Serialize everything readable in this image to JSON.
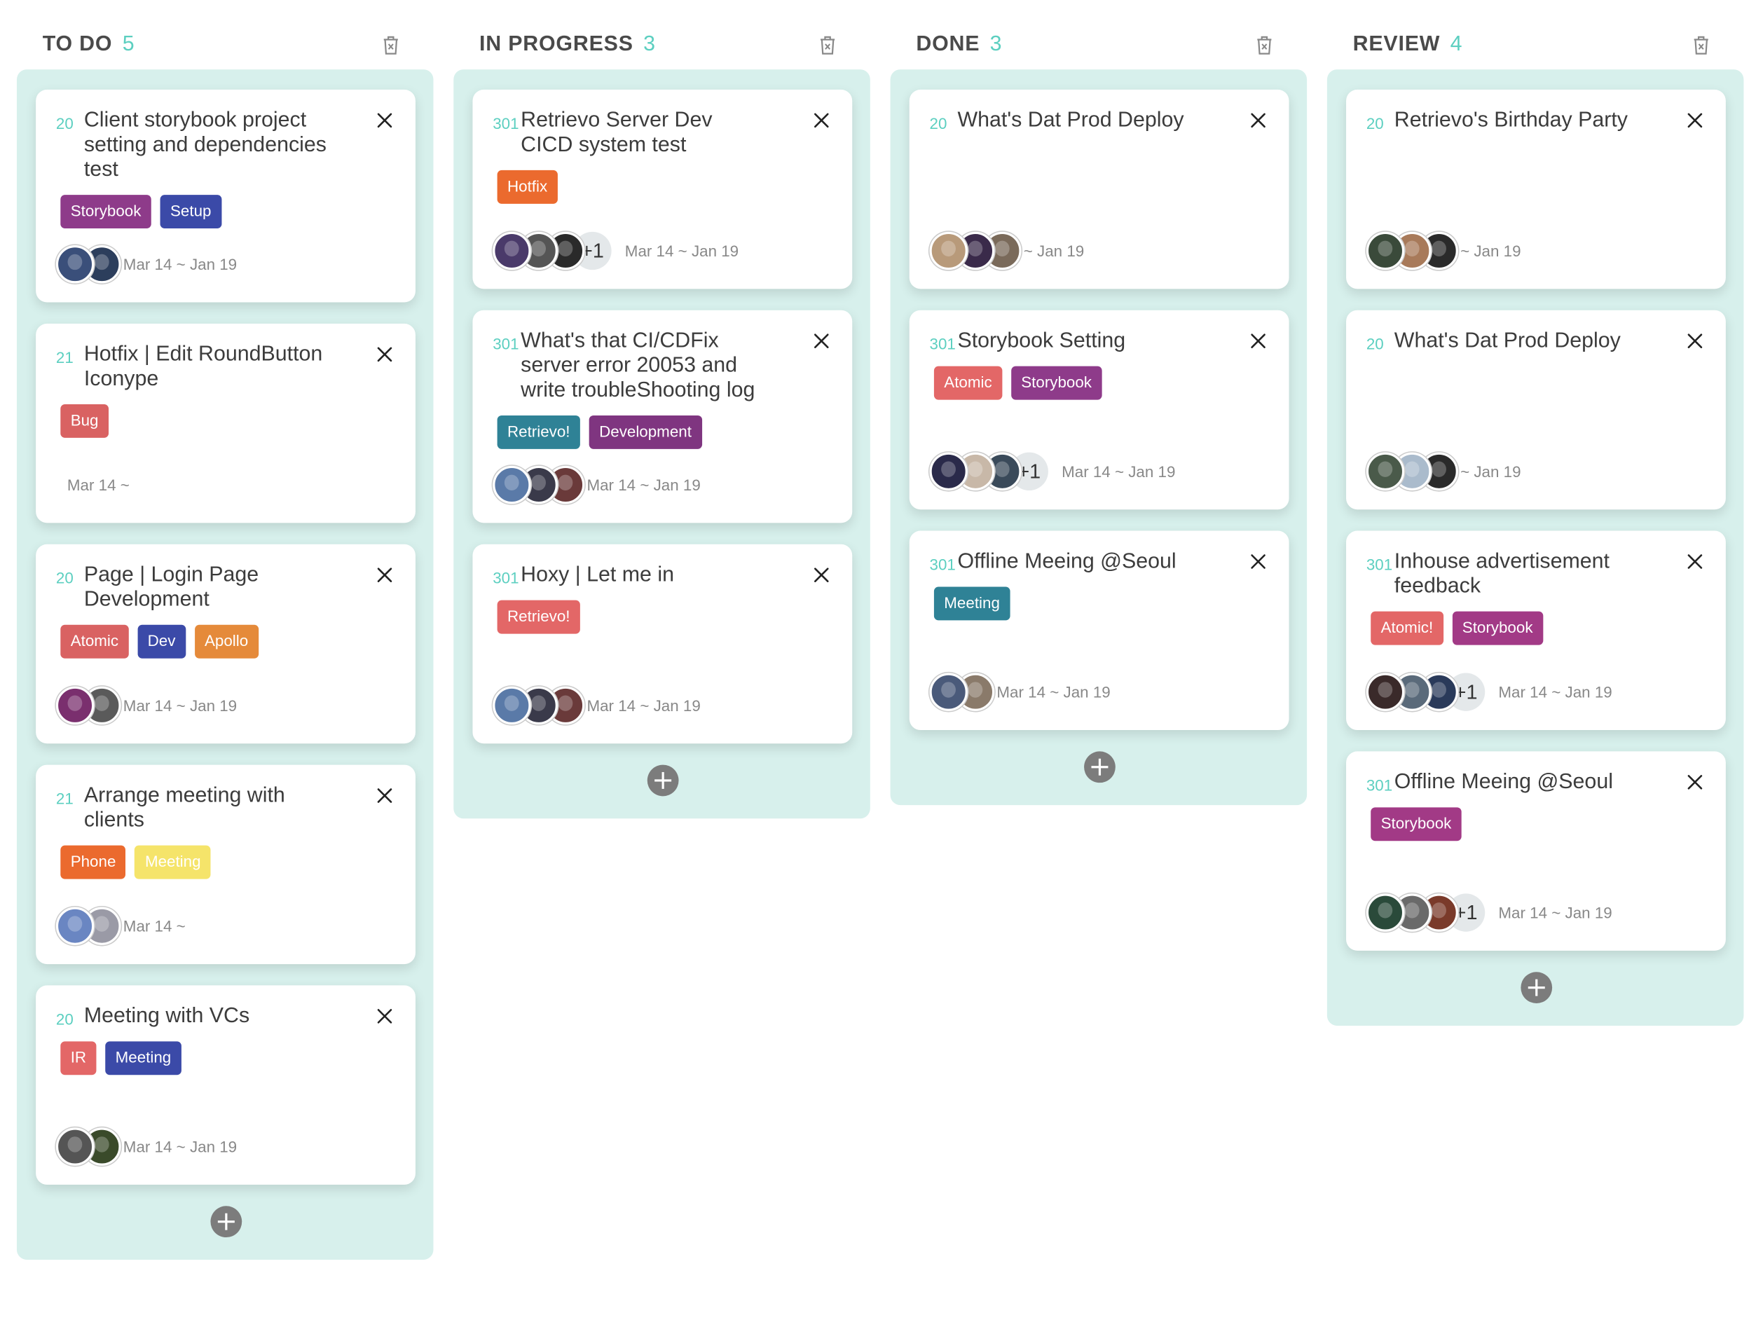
{
  "columns": [
    {
      "title": "TO DO",
      "count": "5",
      "cards": [
        {
          "num": "20",
          "title": "Client storybook project setting and dependencies test",
          "tags": [
            {
              "label": "Storybook",
              "color": "#8e3b8a"
            },
            {
              "label": "Setup",
              "color": "#3b4aa8"
            }
          ],
          "avatars": [
            "#3a4f7a",
            "#2c3e5c"
          ],
          "more": "",
          "dates": "Mar 14 ~ Jan 19"
        },
        {
          "num": "21",
          "title": "Hotfix | Edit RoundButton Iconype",
          "tags": [
            {
              "label": "Bug",
              "color": "#d96262"
            }
          ],
          "avatars": [],
          "more": "",
          "dates": "Mar 14 ~"
        },
        {
          "num": "20",
          "title": "Page | Login Page Development",
          "tags": [
            {
              "label": "Atomic",
              "color": "#d96262"
            },
            {
              "label": "Dev",
              "color": "#3b4aa8"
            },
            {
              "label": "Apollo",
              "color": "#e58a3a"
            }
          ],
          "avatars": [
            "#7a2f6e",
            "#5a5a5a"
          ],
          "more": "",
          "dates": "Mar 14 ~ Jan 19"
        },
        {
          "num": "21",
          "title": "Arrange meeting with clients",
          "tags": [
            {
              "label": "Phone",
              "color": "#eb6a2e"
            },
            {
              "label": "Meeting",
              "color": "#f5e46a"
            }
          ],
          "avatars": [
            "#6a86c2",
            "#9a9aa6"
          ],
          "more": "",
          "dates": "Mar 14 ~"
        },
        {
          "num": "20",
          "title": "Meeting with VCs",
          "tags": [
            {
              "label": "IR",
              "color": "#e36767"
            },
            {
              "label": "Meeting",
              "color": "#3b4aa8"
            }
          ],
          "avatars": [
            "#555555",
            "#3a4a2a"
          ],
          "more": "",
          "dates": "Mar 14 ~ Jan 19"
        }
      ]
    },
    {
      "title": "IN PROGRESS",
      "count": "3",
      "cards": [
        {
          "num": "301",
          "title": "Retrievo Server Dev CICD system test",
          "tags": [
            {
              "label": "Hotfix",
              "color": "#eb6a2e"
            }
          ],
          "avatars": [
            "#4a3a6a",
            "#555555",
            "#2a2a2a"
          ],
          "more": "+1",
          "dates": "Mar 14 ~ Jan 19"
        },
        {
          "num": "301",
          "title": "What's that CI/CDFix server error 20053 and write troubleShooting log",
          "tags": [
            {
              "label": "Retrievo!",
              "color": "#2f8296"
            },
            {
              "label": "Development",
              "color": "#7f3580"
            }
          ],
          "avatars": [
            "#5a7aa8",
            "#3a3a4a",
            "#6a3a3a"
          ],
          "more": "",
          "dates": "Mar 14 ~ Jan 19"
        },
        {
          "num": "301",
          "title": "Hoxy | Let me in",
          "tags": [
            {
              "label": "Retrievo!",
              "color": "#e36767"
            }
          ],
          "avatars": [
            "#5a7aa8",
            "#3a3a4a",
            "#6a3a3a"
          ],
          "more": "",
          "dates": "Mar 14 ~ Jan 19"
        }
      ]
    },
    {
      "title": "DONE",
      "count": "3",
      "cards": [
        {
          "num": "20",
          "title": "What's Dat Prod Deploy",
          "tags": [],
          "avatars": [
            "#b89a7a",
            "#3a2a4a",
            "#7a6a5a"
          ],
          "more": "",
          "dates": "~ Jan 19"
        },
        {
          "num": "301",
          "title": "Storybook Setting",
          "tags": [
            {
              "label": "Atomic",
              "color": "#e36767"
            },
            {
              "label": "Storybook",
              "color": "#8e3b8a"
            }
          ],
          "avatars": [
            "#2a2a4a",
            "#c8b8a8",
            "#3a4a5a"
          ],
          "more": "+1",
          "dates": "Mar 14 ~ Jan 19"
        },
        {
          "num": "301",
          "title": "Offline Meeing @Seoul",
          "tags": [
            {
              "label": "Meeting",
              "color": "#2f8296"
            }
          ],
          "avatars": [
            "#4a5a7a",
            "#8a7a6a"
          ],
          "more": "",
          "dates": "Mar 14 ~ Jan 19"
        }
      ]
    },
    {
      "title": "REVIEW",
      "count": "4",
      "cards": [
        {
          "num": "20",
          "title": "Retrievo's Birthday Party",
          "tags": [],
          "avatars": [
            "#3a4a3a",
            "#a87a5a",
            "#2a2a2a"
          ],
          "more": "",
          "dates": "~ Jan 19"
        },
        {
          "num": "20",
          "title": "What's Dat Prod Deploy",
          "tags": [],
          "avatars": [
            "#4a5a4a",
            "#aabbcc",
            "#2a2a2a"
          ],
          "more": "",
          "dates": "~ Jan 19"
        },
        {
          "num": "301",
          "title": "Inhouse advertisement feedback",
          "tags": [
            {
              "label": "Atomic!",
              "color": "#e36767"
            },
            {
              "label": "Storybook",
              "color": "#a23a86"
            }
          ],
          "avatars": [
            "#3a2a2a",
            "#5a6a7a",
            "#2a3a5a"
          ],
          "more": "+1",
          "dates": "Mar 14 ~ Jan 19"
        },
        {
          "num": "301",
          "title": "Offline Meeing @Seoul",
          "tags": [
            {
              "label": "Storybook",
              "color": "#a23a86"
            }
          ],
          "avatars": [
            "#2a4a3a",
            "#6a6a6a",
            "#7a3a2a"
          ],
          "more": "+1",
          "dates": "Mar 14 ~ Jan 19"
        }
      ]
    }
  ]
}
